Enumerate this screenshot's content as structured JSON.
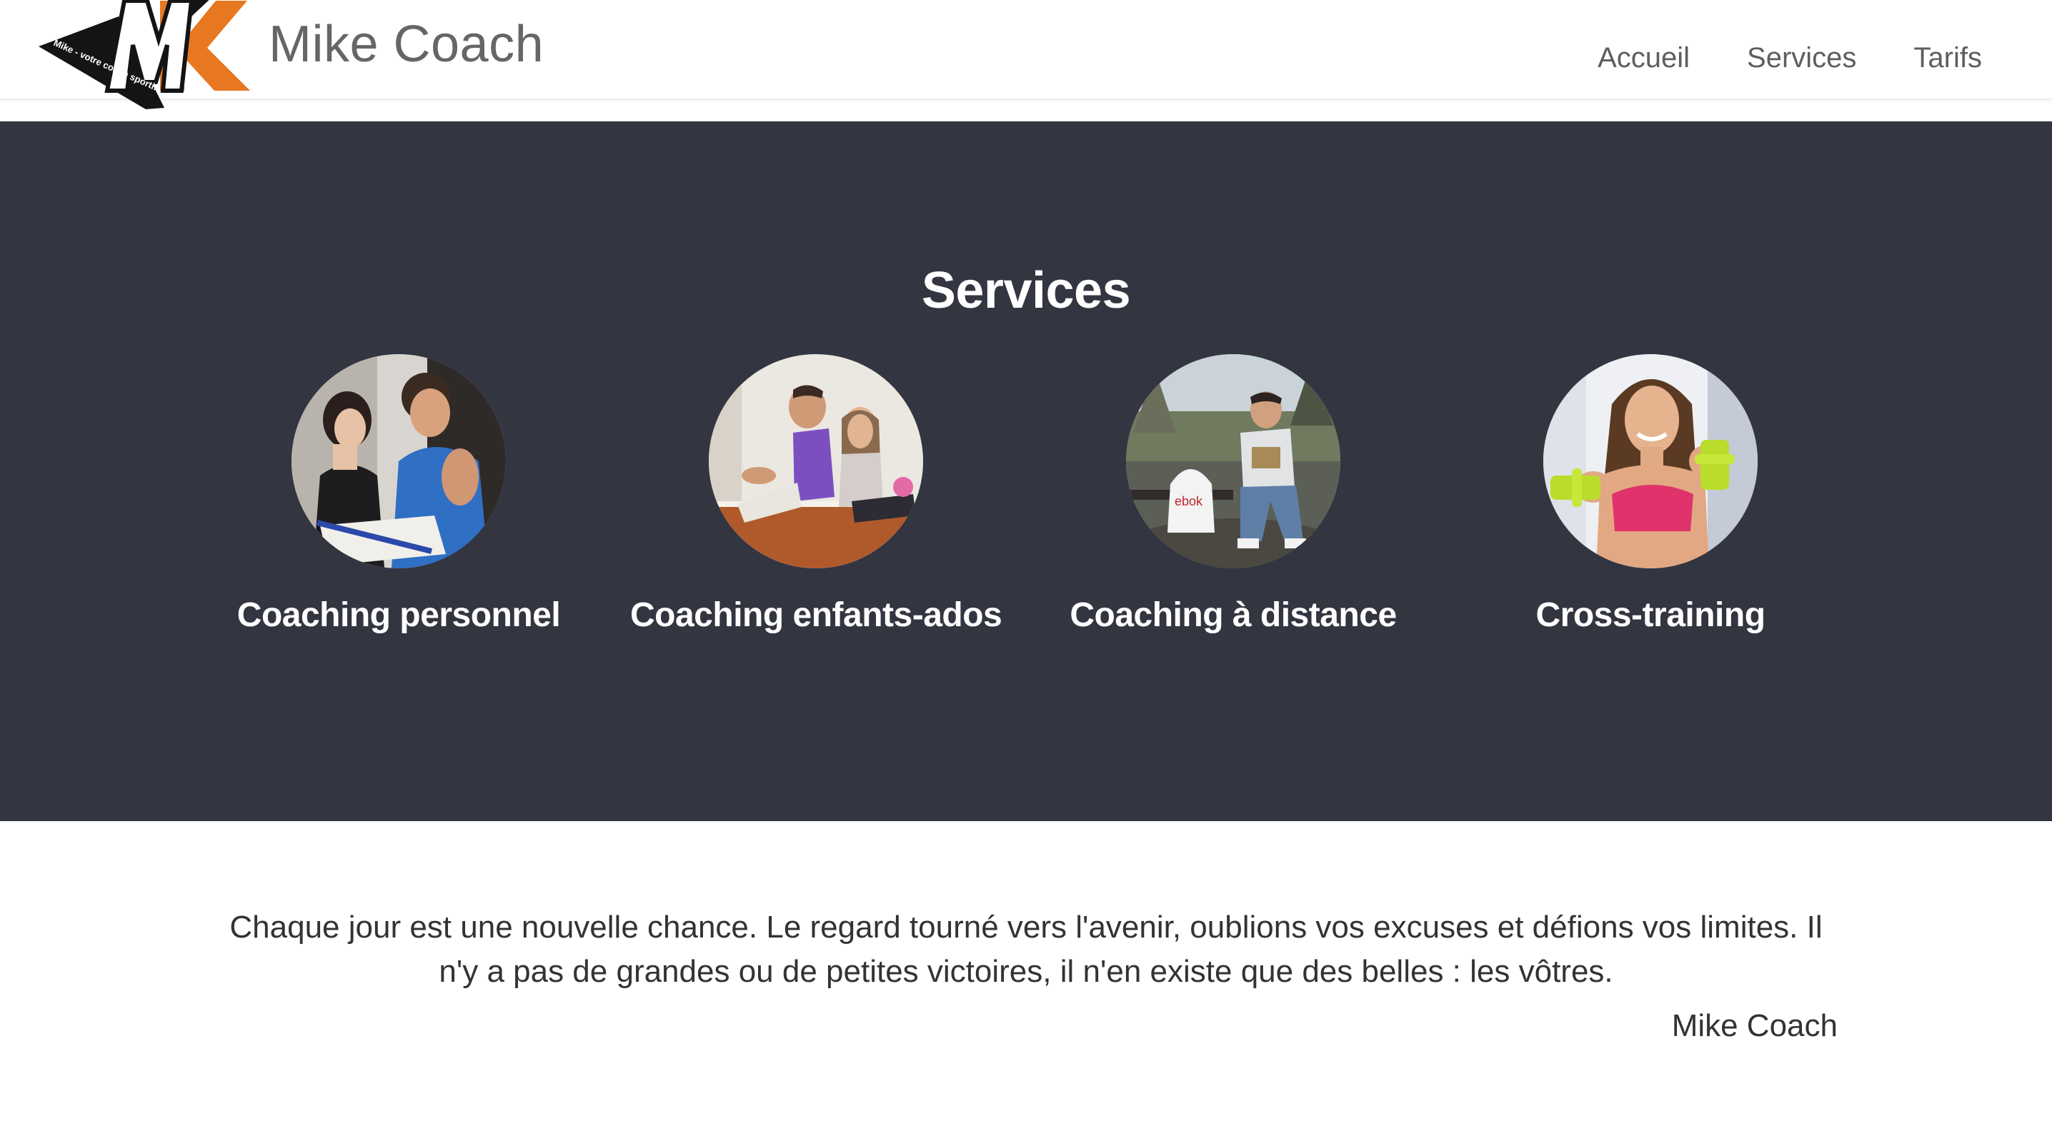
{
  "header": {
    "brand_name": "Mike Coach",
    "logo": {
      "letters": "MK",
      "tagline": "Mike - votre coach sportif",
      "colors": {
        "dark": "#1a1a1a",
        "accent": "#e87722",
        "green": "#7dc242"
      }
    }
  },
  "nav": {
    "items": [
      {
        "label": "Accueil"
      },
      {
        "label": "Services"
      },
      {
        "label": "Tarifs"
      }
    ]
  },
  "services": {
    "title": "Services",
    "background": "#333541",
    "items": [
      {
        "label": "Coaching personnel",
        "photo": "coach-and-client-photo"
      },
      {
        "label": "Coaching enfants-ados",
        "photo": "coach-and-child-photo"
      },
      {
        "label": "Coaching à distance",
        "photo": "remote-coaching-photo"
      },
      {
        "label": "Cross-training",
        "photo": "woman-with-dumbbells-photo"
      }
    ]
  },
  "quote": {
    "text": "Chaque jour est une nouvelle chance. Le regard tourné vers l'avenir, oublions vos excuses et défions vos limites. Il n'y a pas de grandes ou de petites victoires, il n'en existe que des belles : les vôtres.",
    "author": "Mike Coach"
  }
}
